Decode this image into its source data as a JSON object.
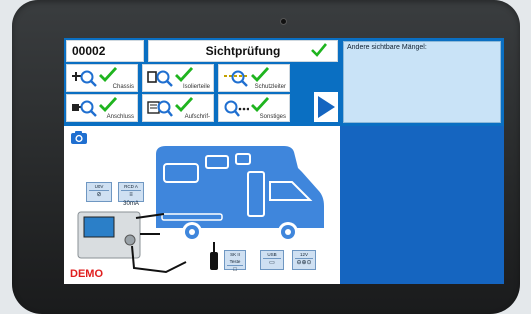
{
  "header": {
    "record_id": "00002",
    "title": "Sichtprüfung"
  },
  "tiles": [
    {
      "label": "Chassis",
      "icon": "chassis-magnifier-icon",
      "checked": true
    },
    {
      "label": "Isolierteile",
      "icon": "insulation-magnifier-icon",
      "checked": true
    },
    {
      "label": "Schutzleiter",
      "icon": "protective-conductor-magnifier-icon",
      "checked": true
    },
    {
      "label": "Anschluss",
      "icon": "plug-magnifier-icon",
      "checked": true
    },
    {
      "label": "Aufschrif-",
      "icon": "label-magnifier-icon",
      "checked": true
    },
    {
      "label": "Sonstiges",
      "icon": "other-magnifier-icon",
      "checked": true
    }
  ],
  "notes": {
    "text": "Andere sichtbare Mängel:"
  },
  "diagram": {
    "demo_label": "DEMO",
    "badges": [
      {
        "label": "U0V",
        "icon": "⊘"
      },
      {
        "label": "RCD A",
        "icon": "≡ 30mA"
      },
      {
        "label": "SK II Teste",
        "icon": "□"
      },
      {
        "label": "USB",
        "icon": "▭"
      },
      {
        "label": "12V",
        "icon": "⊖⊕⊙"
      }
    ]
  },
  "colors": {
    "accent": "#0a6fc2",
    "panel_blue": "#1565c0",
    "check_green": "#1fb41f",
    "demo_red": "#e01e1e",
    "camper_blue": "#3f86dc"
  }
}
